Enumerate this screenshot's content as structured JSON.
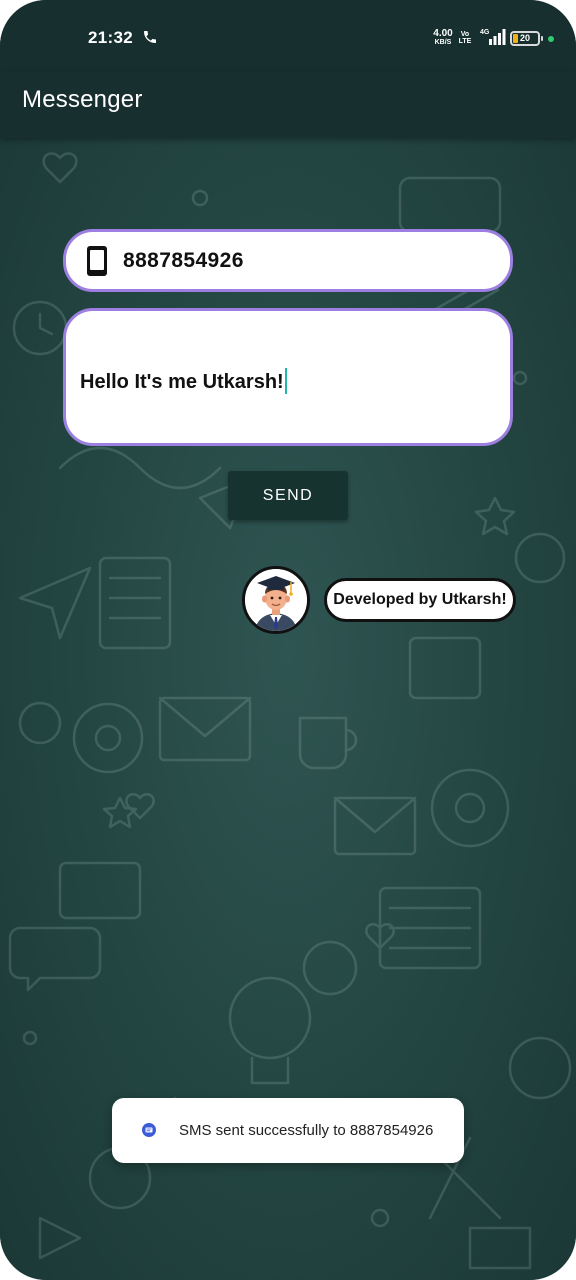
{
  "status_bar": {
    "time": "21:32",
    "network_speed": "4.00",
    "network_speed_unit": "KB/S",
    "volte_top": "Vo",
    "volte_bottom": "LTE",
    "network_type": "4G",
    "battery_level": "20",
    "battery_fraction": 0.2
  },
  "app_bar": {
    "title": "Messenger"
  },
  "form": {
    "phone_value": "8887854926",
    "message_value": "Hello It's me Utkarsh!",
    "send_label": "SEND"
  },
  "credit": {
    "label": "Developed by Utkarsh!"
  },
  "toast": {
    "message": "SMS sent successfully to 8887854926"
  },
  "colors": {
    "app_bar": "#17302f",
    "background": "#254844",
    "field_border": "#9c7fe0",
    "caret": "#1fb8a8",
    "send_button": "#17332f"
  },
  "icons": {
    "call": "phone-call-icon",
    "signal": "signal-bars-icon",
    "battery": "battery-icon",
    "phone_field": "smartphone-icon",
    "toast": "messages-app-icon"
  }
}
